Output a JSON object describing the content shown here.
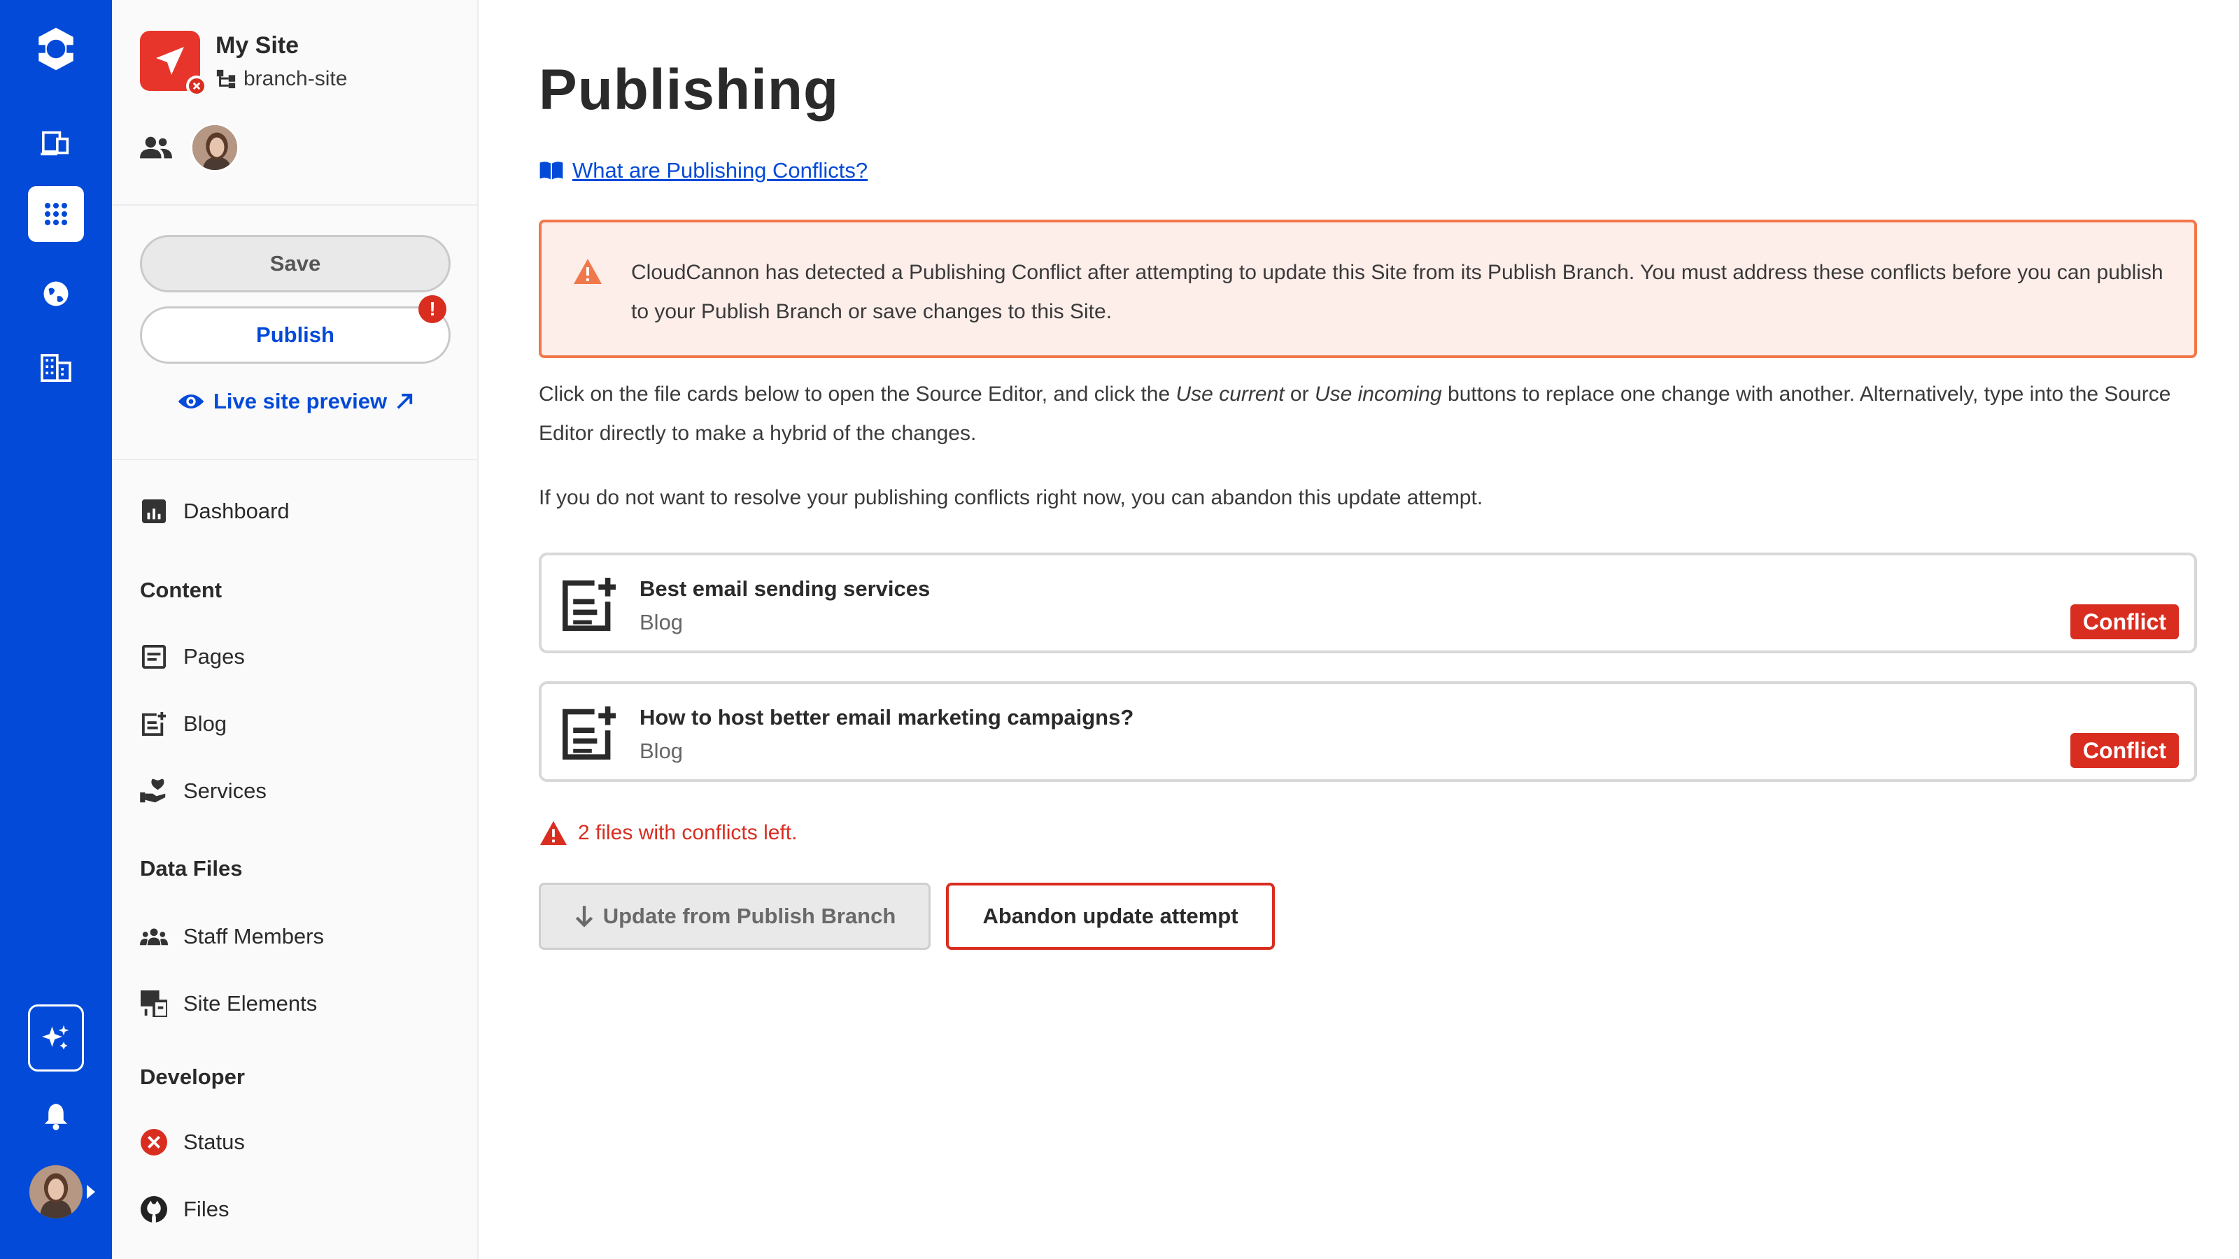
{
  "rail": {
    "icons": [
      "cloudcannon-logo-icon",
      "devices-icon",
      "apps-grid-icon",
      "globe-icon",
      "organization-icon",
      "sparkles-icon",
      "bell-icon",
      "user-avatar"
    ]
  },
  "site": {
    "name": "My Site",
    "branch": "branch-site"
  },
  "actions": {
    "save_label": "Save",
    "publish_label": "Publish",
    "publish_alert": "!",
    "live_preview_label": "Live site preview"
  },
  "nav": {
    "dashboard": "Dashboard",
    "content_heading": "Content",
    "pages": "Pages",
    "blog": "Blog",
    "services": "Services",
    "data_heading": "Data Files",
    "staff": "Staff Members",
    "elements": "Site Elements",
    "developer_heading": "Developer",
    "status": "Status",
    "files": "Files"
  },
  "main": {
    "title": "Publishing",
    "help_link": "What are Publishing Conflicts?",
    "warning": "CloudCannon has detected a Publishing Conflict after attempting to update this Site from its Publish Branch. You must address these conflicts before you can publish to your Publish Branch or save changes to this Site.",
    "instructions_part1": "Click on the file cards below to open the Source Editor, and click the ",
    "instructions_em1": "Use current",
    "instructions_part2": " or ",
    "instructions_em2": "Use incoming",
    "instructions_part3": " buttons to replace one change with another. Alternatively, type into the Source Editor directly to make a hybrid of the changes.",
    "abandon_note": "If you do not want to resolve your publishing conflicts right now, you can abandon this update attempt.",
    "files": [
      {
        "title": "Best email sending services",
        "collection": "Blog",
        "badge": "Conflict"
      },
      {
        "title": "How to host better email marketing campaigns?",
        "collection": "Blog",
        "badge": "Conflict"
      }
    ],
    "conflicts_left": "2 files with conflicts left.",
    "update_button": "Update from Publish Branch",
    "abandon_button": "Abandon update attempt"
  },
  "colors": {
    "brand": "#034ad8",
    "danger": "#d92d20",
    "warning_border": "#f0784a",
    "warning_bg": "#fdeeea"
  }
}
